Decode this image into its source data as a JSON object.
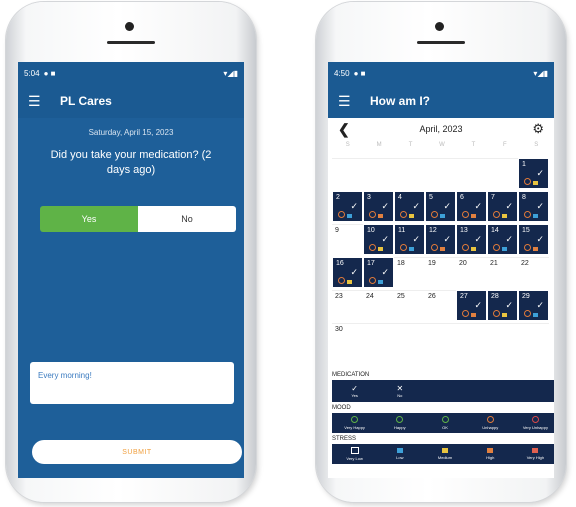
{
  "left_screen": {
    "status_time": "5:04",
    "app_title": "PL Cares",
    "date": "Saturday, April 15, 2023",
    "question": "Did you take your medication? (2 days ago)",
    "yes_label": "Yes",
    "no_label": "No",
    "note_text": "Every morning!",
    "submit_label": "SUBMIT"
  },
  "right_screen": {
    "status_time": "4:50",
    "app_title": "How am I?",
    "month_label": "April, 2023",
    "weekday_headers": [
      "S",
      "M",
      "T",
      "W",
      "T",
      "F",
      "S"
    ],
    "calendar_days": [
      {
        "day": "",
        "filled": false
      },
      {
        "day": "",
        "filled": false
      },
      {
        "day": "",
        "filled": false
      },
      {
        "day": "",
        "filled": false
      },
      {
        "day": "",
        "filled": false
      },
      {
        "day": "",
        "filled": false
      },
      {
        "day": "1",
        "filled": true
      },
      {
        "day": "2",
        "filled": true
      },
      {
        "day": "3",
        "filled": true
      },
      {
        "day": "4",
        "filled": true
      },
      {
        "day": "5",
        "filled": true
      },
      {
        "day": "6",
        "filled": true
      },
      {
        "day": "7",
        "filled": true
      },
      {
        "day": "8",
        "filled": true
      },
      {
        "day": "9",
        "filled": false
      },
      {
        "day": "10",
        "filled": true
      },
      {
        "day": "11",
        "filled": true
      },
      {
        "day": "12",
        "filled": true
      },
      {
        "day": "13",
        "filled": true
      },
      {
        "day": "14",
        "filled": true
      },
      {
        "day": "15",
        "filled": true
      },
      {
        "day": "16",
        "filled": true
      },
      {
        "day": "17",
        "filled": true
      },
      {
        "day": "18",
        "filled": false
      },
      {
        "day": "19",
        "filled": false
      },
      {
        "day": "20",
        "filled": false
      },
      {
        "day": "21",
        "filled": false
      },
      {
        "day": "22",
        "filled": false
      },
      {
        "day": "23",
        "filled": false
      },
      {
        "day": "24",
        "filled": false
      },
      {
        "day": "25",
        "filled": false
      },
      {
        "day": "26",
        "filled": false
      },
      {
        "day": "27",
        "filled": true
      },
      {
        "day": "28",
        "filled": true
      },
      {
        "day": "29",
        "filled": true
      },
      {
        "day": "30",
        "filled": false
      },
      {
        "day": "",
        "filled": false
      },
      {
        "day": "",
        "filled": false
      },
      {
        "day": "",
        "filled": false
      },
      {
        "day": "",
        "filled": false
      },
      {
        "day": "",
        "filled": false
      },
      {
        "day": "",
        "filled": false
      }
    ],
    "legend": {
      "medication_label": "MEDICATION",
      "medication_items": [
        "Yes",
        "No"
      ],
      "mood_label": "MOOD",
      "mood_items": [
        "Very Happy",
        "Happy",
        "OK",
        "Unhappy",
        "Very Unhappy"
      ],
      "stress_label": "STRESS",
      "stress_items": [
        "Very Low",
        "Low",
        "Medium",
        "High",
        "Very High"
      ]
    }
  },
  "colors": {
    "primary_blue": "#1b5a92",
    "navy": "#14284d",
    "yes_green": "#5fb347",
    "submit_orange": "#f0a040"
  }
}
